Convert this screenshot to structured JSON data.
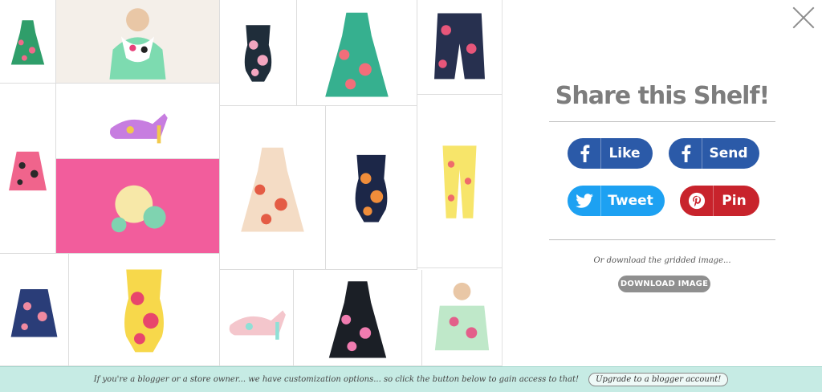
{
  "grid": {
    "items": [
      {
        "name": "green-floral-dress",
        "icon": "dress-icon",
        "bg": "#ffffff",
        "main": "#2f9e6a",
        "accent": "#f06a8a"
      },
      {
        "name": "polka-dot-scarf-model",
        "icon": "scarf-icon",
        "bg": "#f4efe9",
        "main": "#7ddbb0",
        "accent": "#e8407a"
      },
      {
        "name": "pink-floral-top-skirt",
        "icon": "skirt-icon",
        "bg": "#ffffff",
        "main": "#f0648c",
        "accent": "#2a2a2a"
      },
      {
        "name": "floral-heels",
        "icon": "shoe-icon",
        "bg": "#ffffff",
        "main": "#c77de0",
        "accent": "#f2c94c"
      },
      {
        "name": "pink-floral-fabric",
        "icon": "fabric-icon",
        "bg": "#f25d9c",
        "main": "#f7e8a8",
        "accent": "#7fd3b0"
      },
      {
        "name": "black-floral-swimsuit",
        "icon": "swimsuit-icon",
        "bg": "#ffffff",
        "main": "#1f2d3a",
        "accent": "#f3a6c0"
      },
      {
        "name": "green-strapless-dress",
        "icon": "dress-icon",
        "bg": "#ffffff",
        "main": "#36b08f",
        "accent": "#f26e7a"
      },
      {
        "name": "navy-floral-shorts",
        "icon": "shorts-icon",
        "bg": "#ffffff",
        "main": "#27304f",
        "accent": "#e7567a"
      },
      {
        "name": "cream-floral-dress",
        "icon": "dress-icon",
        "bg": "#ffffff",
        "main": "#f4dcc5",
        "accent": "#e45c45"
      },
      {
        "name": "navy-floral-swimsuit",
        "icon": "swimsuit-icon",
        "bg": "#ffffff",
        "main": "#1c2748",
        "accent": "#f08d3a"
      },
      {
        "name": "yellow-floral-jeans",
        "icon": "pants-icon",
        "bg": "#ffffff",
        "main": "#f7e56a",
        "accent": "#ef6b6b"
      },
      {
        "name": "blue-wrap-skirt",
        "icon": "skirt-icon",
        "bg": "#ffffff",
        "main": "#2a3d78",
        "accent": "#f08aa0"
      },
      {
        "name": "yellow-floral-swimsuit",
        "icon": "swimsuit-icon",
        "bg": "#ffffff",
        "main": "#f7d84b",
        "accent": "#e8456c"
      },
      {
        "name": "strappy-floral-heels",
        "icon": "shoe-icon",
        "bg": "#ffffff",
        "main": "#f4c6cc",
        "accent": "#8fe0d6"
      },
      {
        "name": "black-floral-dress",
        "icon": "dress-icon",
        "bg": "#ffffff",
        "main": "#1b1f26",
        "accent": "#f07cb0"
      },
      {
        "name": "mint-floral-top-model",
        "icon": "top-icon",
        "bg": "#ffffff",
        "main": "#bfe8c9",
        "accent": "#e35f8a"
      }
    ]
  },
  "share": {
    "title": "Share this Shelf!",
    "buttons": {
      "fb_like": {
        "label": "Like",
        "icon": "facebook-icon",
        "color": "#2b5aa8"
      },
      "fb_send": {
        "label": "Send",
        "icon": "facebook-icon",
        "color": "#2b5aa8"
      },
      "tweet": {
        "label": "Tweet",
        "icon": "twitter-icon",
        "color": "#1da1f2"
      },
      "pin": {
        "label": "Pin",
        "icon": "pinterest-icon",
        "color": "#c8232c"
      }
    },
    "or_text": "Or download the gridded image...",
    "download_label": "DOWNLOAD IMAGE"
  },
  "footer": {
    "text": "If you're a blogger or a store owner... we have customization options... so click the button below to gain access to that!",
    "upgrade_label": "Upgrade to a blogger account!",
    "bg": "#c6ebe4"
  },
  "close_icon": "close-icon"
}
